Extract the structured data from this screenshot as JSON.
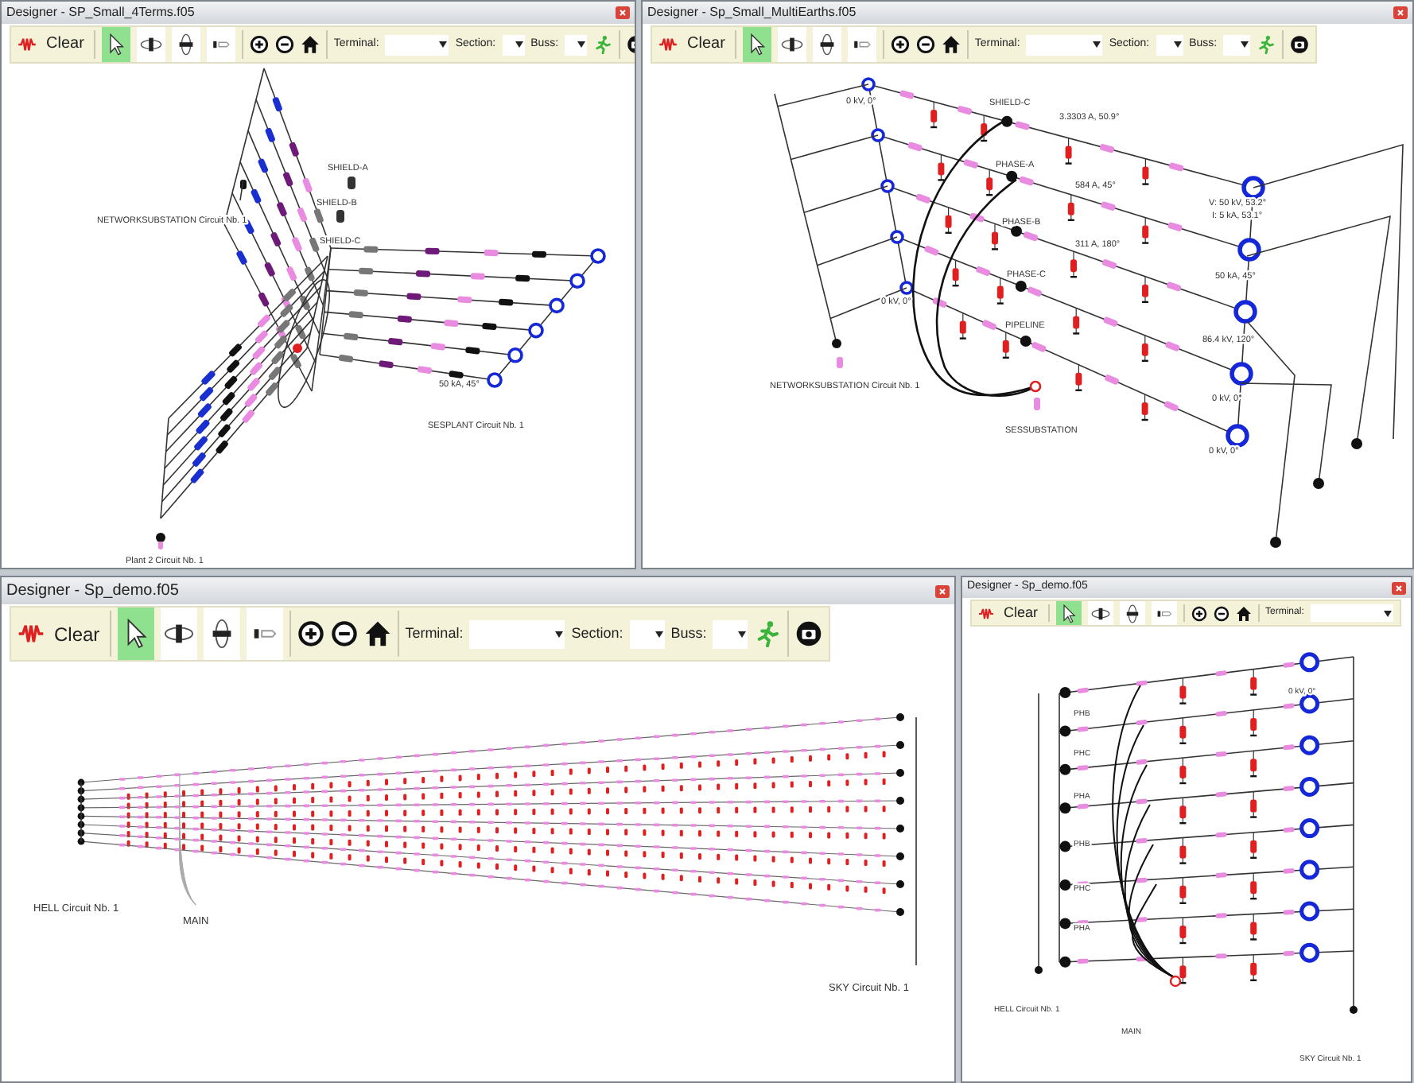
{
  "windows": [
    {
      "title": "Designer - SP_Small_4Terms.f05",
      "toolbar": [
        {
          "kind": "wave"
        },
        {
          "kind": "button",
          "label": "Clear"
        },
        {
          "kind": "separator"
        },
        {
          "kind": "pointer",
          "selected": true
        },
        {
          "kind": "rotate",
          "selected": false
        },
        {
          "kind": "flip",
          "selected": false
        },
        {
          "kind": "tag",
          "selected": false
        },
        {
          "kind": "separator"
        },
        {
          "kind": "zoom-in"
        },
        {
          "kind": "zoom-out"
        },
        {
          "kind": "home"
        },
        {
          "kind": "separator"
        },
        {
          "kind": "combo",
          "label": "Terminal:"
        },
        {
          "kind": "combo",
          "label": "Section:"
        },
        {
          "kind": "combo",
          "label": "Buss:"
        },
        {
          "kind": "run"
        },
        {
          "kind": "separator"
        },
        {
          "kind": "camera"
        }
      ],
      "labels": [
        "SHIELD-A",
        "SHIELD-B",
        "SHIELD-C",
        "NETWORKSUBSTATION Circuit Nb. 1",
        "SESPLANT Circuit Nb. 1",
        "Plant 2 Circuit Nb. 1",
        "50 kA, 45°"
      ]
    },
    {
      "title": "Designer - Sp_Small_MultiEarths.f05",
      "toolbar": [
        {
          "kind": "wave"
        },
        {
          "kind": "button",
          "label": "Clear"
        },
        {
          "kind": "separator"
        },
        {
          "kind": "pointer",
          "selected": true
        },
        {
          "kind": "rotate",
          "selected": false
        },
        {
          "kind": "flip",
          "selected": false
        },
        {
          "kind": "tag",
          "selected": false
        },
        {
          "kind": "separator"
        },
        {
          "kind": "zoom-in"
        },
        {
          "kind": "zoom-out"
        },
        {
          "kind": "home"
        },
        {
          "kind": "separator"
        },
        {
          "kind": "combo",
          "label": "Terminal:"
        },
        {
          "kind": "combo",
          "label": "Section:"
        },
        {
          "kind": "combo",
          "label": "Buss:"
        },
        {
          "kind": "run"
        },
        {
          "kind": "separator"
        },
        {
          "kind": "camera"
        }
      ],
      "labels": [
        "0 kV, 0°",
        "SHIELD-C",
        "PHASE-A",
        "PHASE-B",
        "PHASE-C",
        "PIPELINE",
        "NETWORKSUBSTATION Circuit Nb. 1",
        "SESSUBSTATION",
        "V: 50 kV, 53.2°",
        "I: 5 kA, 53.1°",
        "50 kA, 45°",
        "86.4 kV, 120°",
        "0 kV, 0°",
        "0 kV, 0°",
        "3.3303 A, 50.9°",
        "584 A, 45°",
        "311 A, 180°",
        "0 kV, 0°"
      ]
    },
    {
      "title": "Designer - Sp_demo.f05",
      "toolbar": [
        {
          "kind": "wave"
        },
        {
          "kind": "button",
          "label": "Clear"
        },
        {
          "kind": "separator"
        },
        {
          "kind": "pointer",
          "selected": true
        },
        {
          "kind": "rotate",
          "selected": false
        },
        {
          "kind": "flip",
          "selected": false
        },
        {
          "kind": "tag",
          "selected": false
        },
        {
          "kind": "separator"
        },
        {
          "kind": "zoom-in"
        },
        {
          "kind": "zoom-out"
        },
        {
          "kind": "home"
        },
        {
          "kind": "separator"
        },
        {
          "kind": "combo",
          "label": "Terminal:"
        },
        {
          "kind": "combo",
          "label": "Section:"
        },
        {
          "kind": "combo",
          "label": "Buss:"
        },
        {
          "kind": "run"
        },
        {
          "kind": "separator"
        },
        {
          "kind": "camera"
        }
      ],
      "labels": [
        "HELL Circuit Nb. 1",
        "MAIN",
        "SKY Circuit Nb. 1"
      ]
    },
    {
      "title": "Designer - Sp_demo.f05",
      "toolbar": [
        {
          "kind": "wave"
        },
        {
          "kind": "button",
          "label": "Clear"
        },
        {
          "kind": "separator"
        },
        {
          "kind": "pointer",
          "selected": true
        },
        {
          "kind": "rotate",
          "selected": false
        },
        {
          "kind": "flip",
          "selected": false
        },
        {
          "kind": "tag",
          "selected": false
        },
        {
          "kind": "separator"
        },
        {
          "kind": "zoom-in"
        },
        {
          "kind": "zoom-out"
        },
        {
          "kind": "home"
        },
        {
          "kind": "separator"
        },
        {
          "kind": "combo",
          "label": "Terminal:"
        }
      ],
      "labels": [
        "0 kV, 0°",
        "PHB",
        "PHC",
        "PHA",
        "PHB",
        "PHC",
        "PHA",
        "HELL Circuit Nb. 1",
        "MAIN",
        "SKY Circuit Nb. 1"
      ]
    }
  ]
}
